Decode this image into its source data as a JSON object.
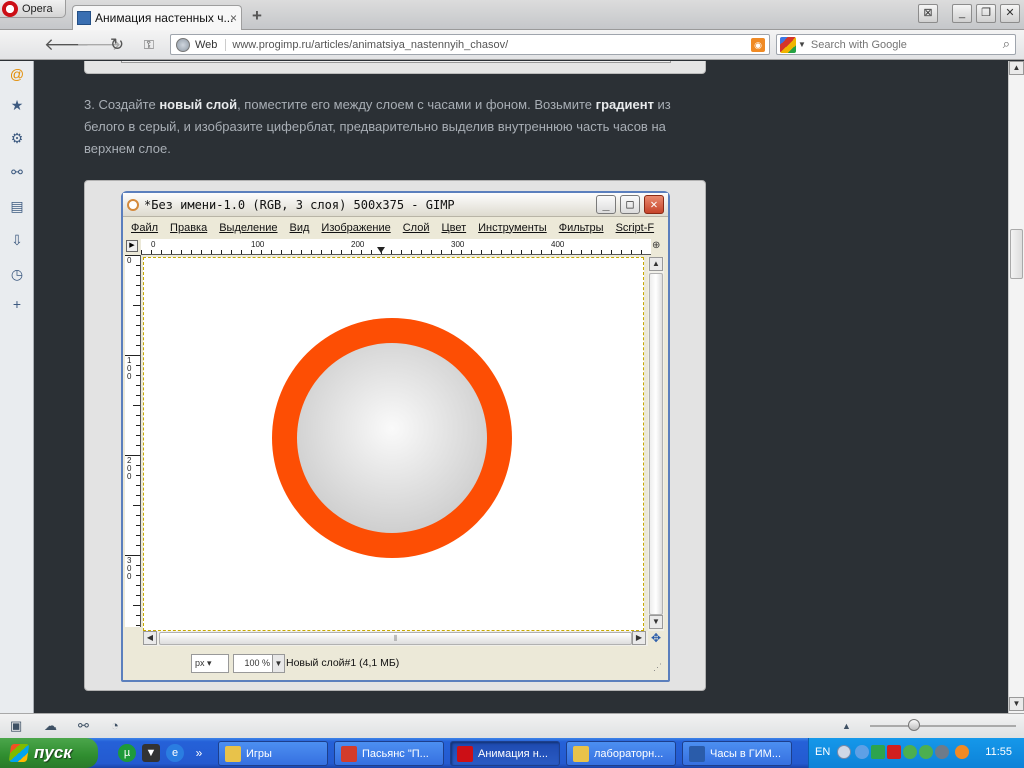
{
  "browser": {
    "menu_label": "Opera",
    "tab": {
      "title": "Анимация настенных ч...",
      "close": "×"
    },
    "new_tab": "+",
    "address": {
      "web_label": "Web",
      "url": "www.progimp.ru/articles/animatsiya_nastennyih_chasov/"
    },
    "search_placeholder": "Search with Google"
  },
  "article": {
    "step_text_1": "3. Создайте ",
    "step_bold_1": "новый слой",
    "step_text_2": ", поместите его между слоем с часами и фоном. Возьмите ",
    "step_bold_2": "градиент",
    "step_text_3": " из белого в серый, и изобразите циферблат, предварительно выделив внутреннюю часть часов на верхнем слое."
  },
  "gimp": {
    "title": "*Без имени-1.0 (RGB, 3 слоя) 500x375 - GIMP",
    "menu": [
      "Файл",
      "Правка",
      "Выделение",
      "Вид",
      "Изображение",
      "Слой",
      "Цвет",
      "Инструменты",
      "Фильтры",
      "Script-F"
    ],
    "hruler_labels": [
      "0",
      "100",
      "200",
      "300",
      "400"
    ],
    "vruler_labels": [
      "0",
      "1\n0\n0",
      "2\n0\n0",
      "3\n0\n0"
    ],
    "unit": "px",
    "zoom": "100 %",
    "layer_status": "Новый слой#1 (4,1 МБ)",
    "colors": {
      "ring": "#fd4e04",
      "face_light": "#fafafa",
      "face_dark": "#cfcfcf"
    }
  },
  "taskbar": {
    "start_label": "пуск",
    "tasks": [
      {
        "label": "Игры",
        "color": "#e8c24a"
      },
      {
        "label": "Пасьянс \"П...",
        "color": "#d23c2c"
      },
      {
        "label": "Анимация н...",
        "color": "#cc0f16"
      },
      {
        "label": "лабораторн...",
        "color": "#e8c24a"
      },
      {
        "label": "Часы в ГИМ...",
        "color": "#2a5caa"
      },
      {
        "label": "",
        "color": "#3a6fb2"
      }
    ],
    "lang": "EN",
    "clock": "11:55"
  }
}
